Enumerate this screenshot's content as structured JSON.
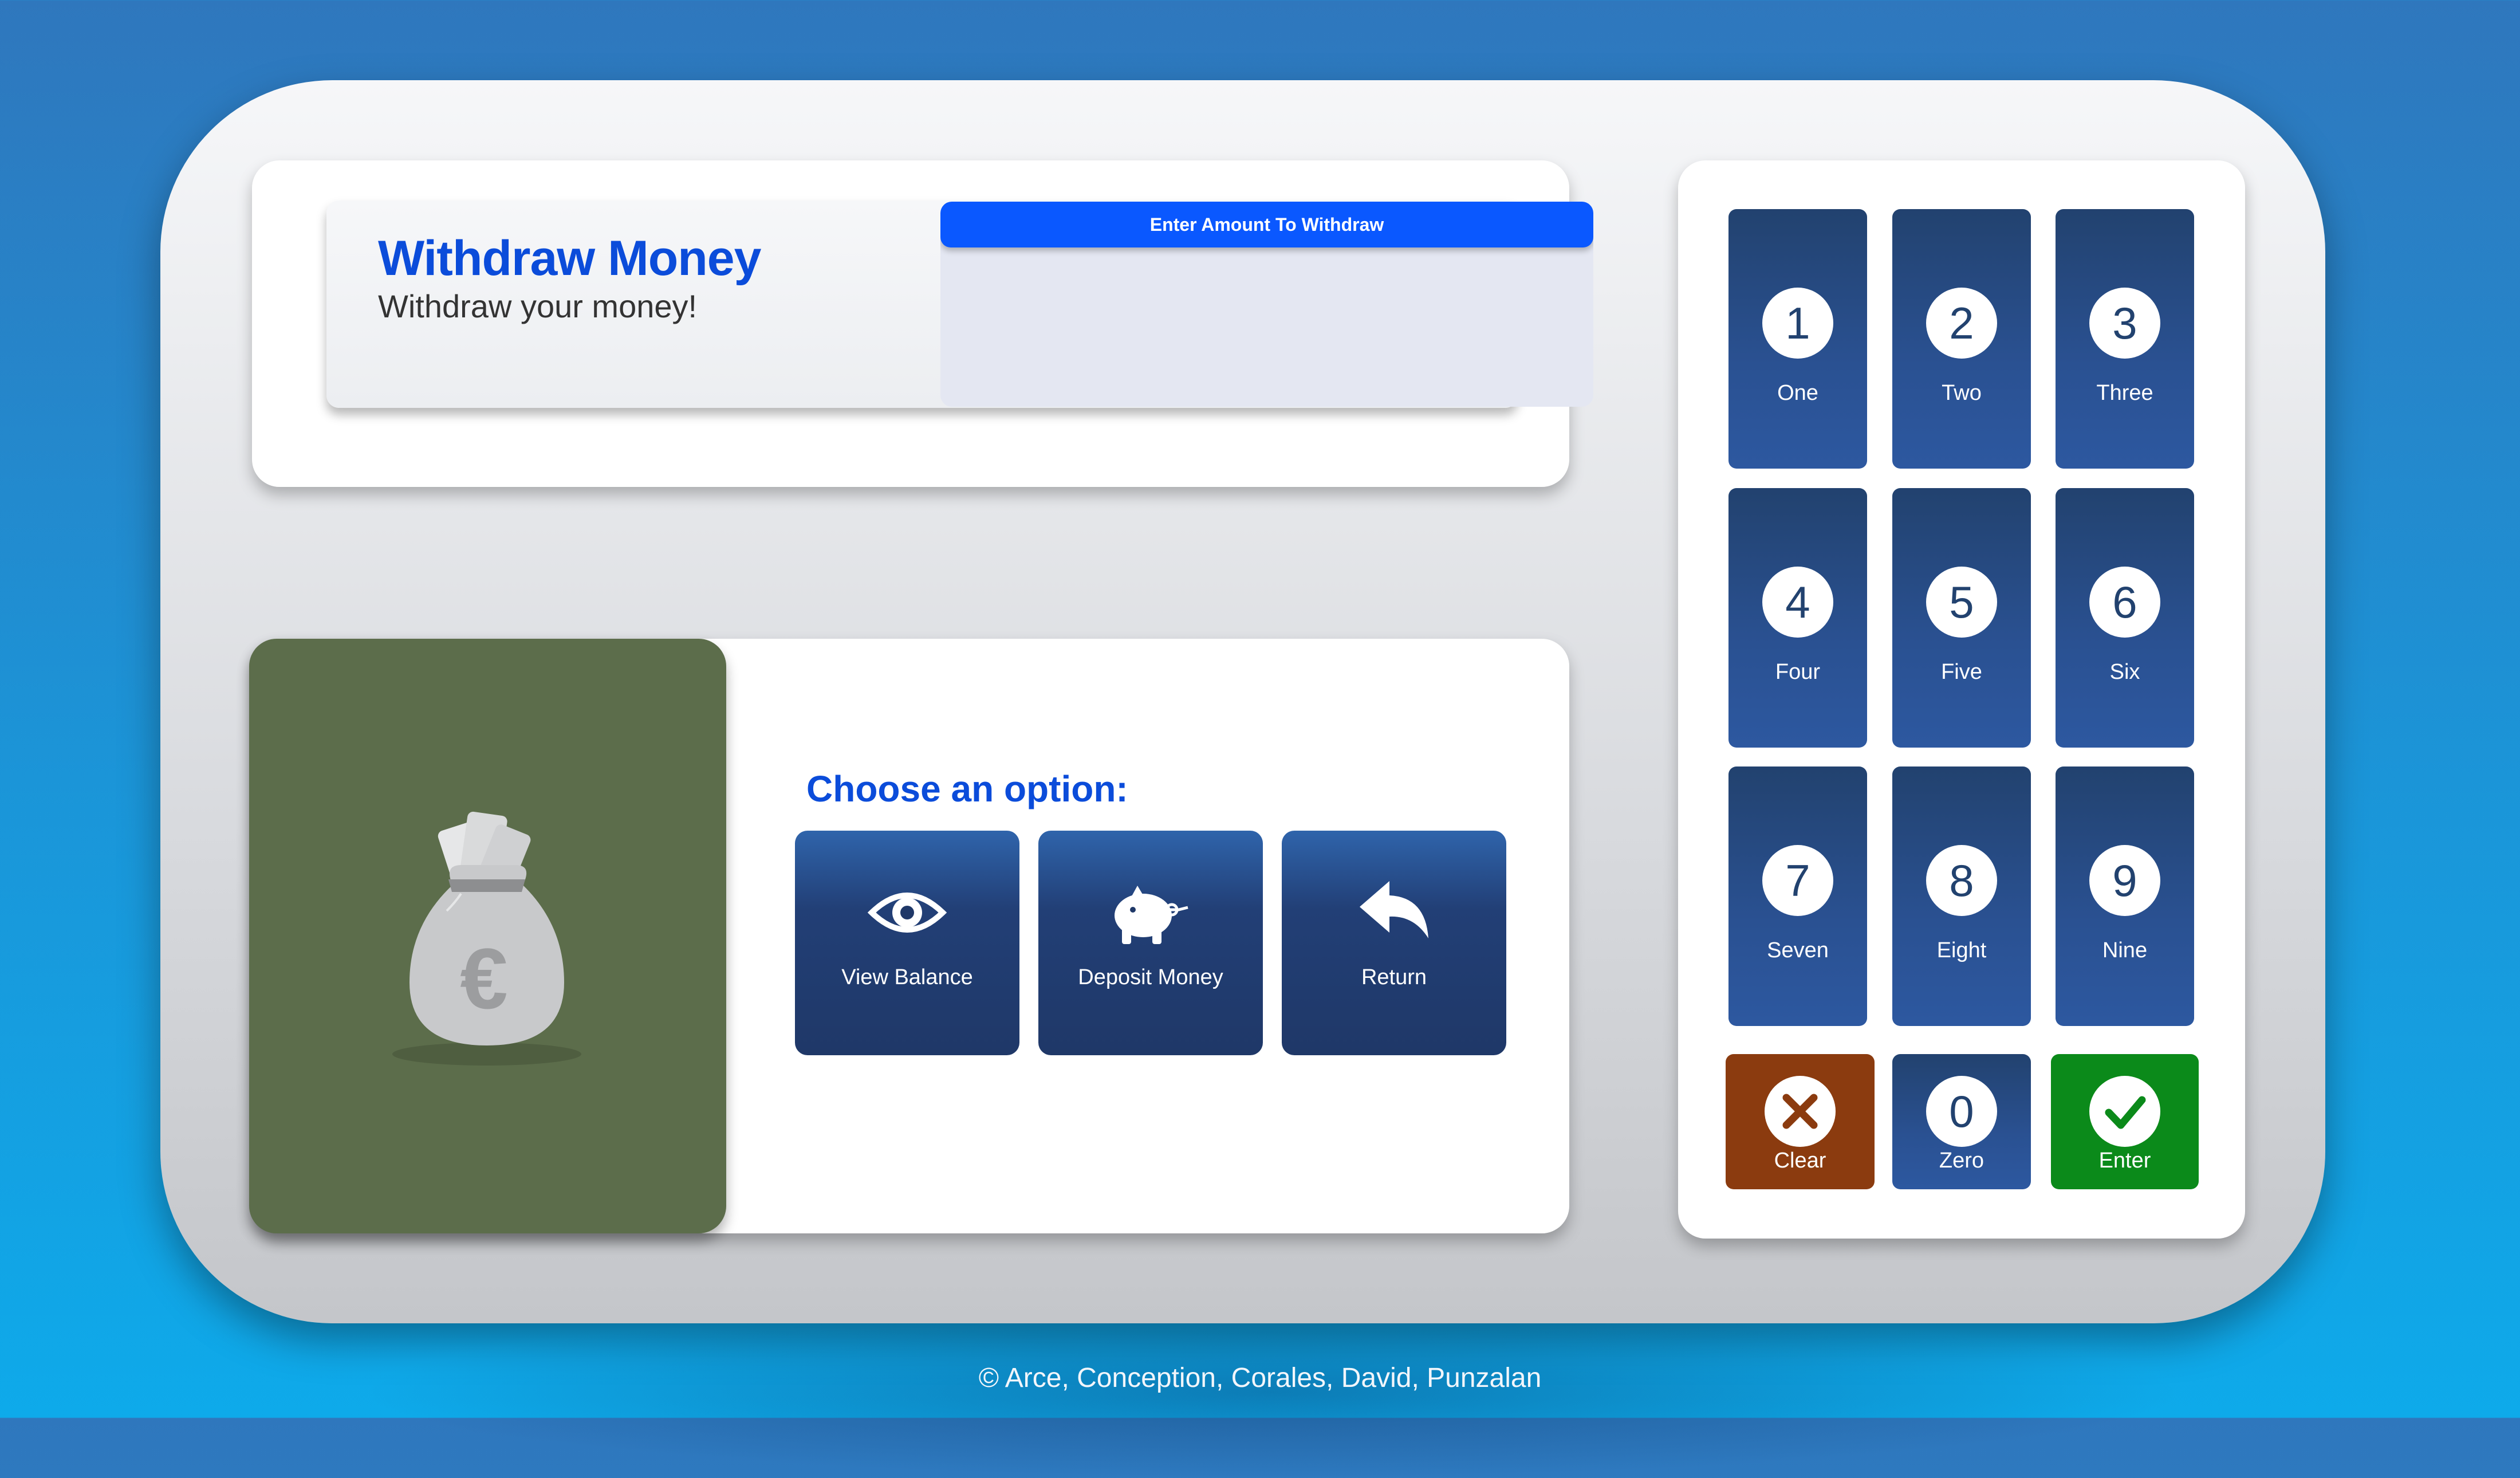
{
  "header": {
    "title": "Withdraw Money",
    "subtitle": "Withdraw your money!"
  },
  "amount": {
    "label": "Enter Amount To Withdraw",
    "value": ""
  },
  "options": {
    "heading": "Choose an option:",
    "items": [
      {
        "label": "View Balance",
        "icon": "eye-icon"
      },
      {
        "label": "Deposit Money",
        "icon": "piggy-bank-icon"
      },
      {
        "label": "Return",
        "icon": "return-arrow-icon"
      }
    ]
  },
  "illustration": {
    "icon": "money-bag-icon",
    "symbol": "€"
  },
  "keypad": {
    "keys": [
      {
        "digit": "1",
        "label": "One"
      },
      {
        "digit": "2",
        "label": "Two"
      },
      {
        "digit": "3",
        "label": "Three"
      },
      {
        "digit": "4",
        "label": "Four"
      },
      {
        "digit": "5",
        "label": "Five"
      },
      {
        "digit": "6",
        "label": "Six"
      },
      {
        "digit": "7",
        "label": "Seven"
      },
      {
        "digit": "8",
        "label": "Eight"
      },
      {
        "digit": "9",
        "label": "Nine"
      },
      {
        "digit": "0",
        "label": "Zero"
      }
    ],
    "clear": {
      "label": "Clear",
      "icon": "close-icon"
    },
    "enter": {
      "label": "Enter",
      "icon": "check-icon"
    }
  },
  "colors": {
    "accent": "#0b4cda",
    "button": "#22426f",
    "clear": "#8b3b0f",
    "enter": "#0b8a1a",
    "image_bg": "#5c6d4b"
  },
  "footer": {
    "credits": "© Arce, Conception, Corales, David, Punzalan"
  }
}
